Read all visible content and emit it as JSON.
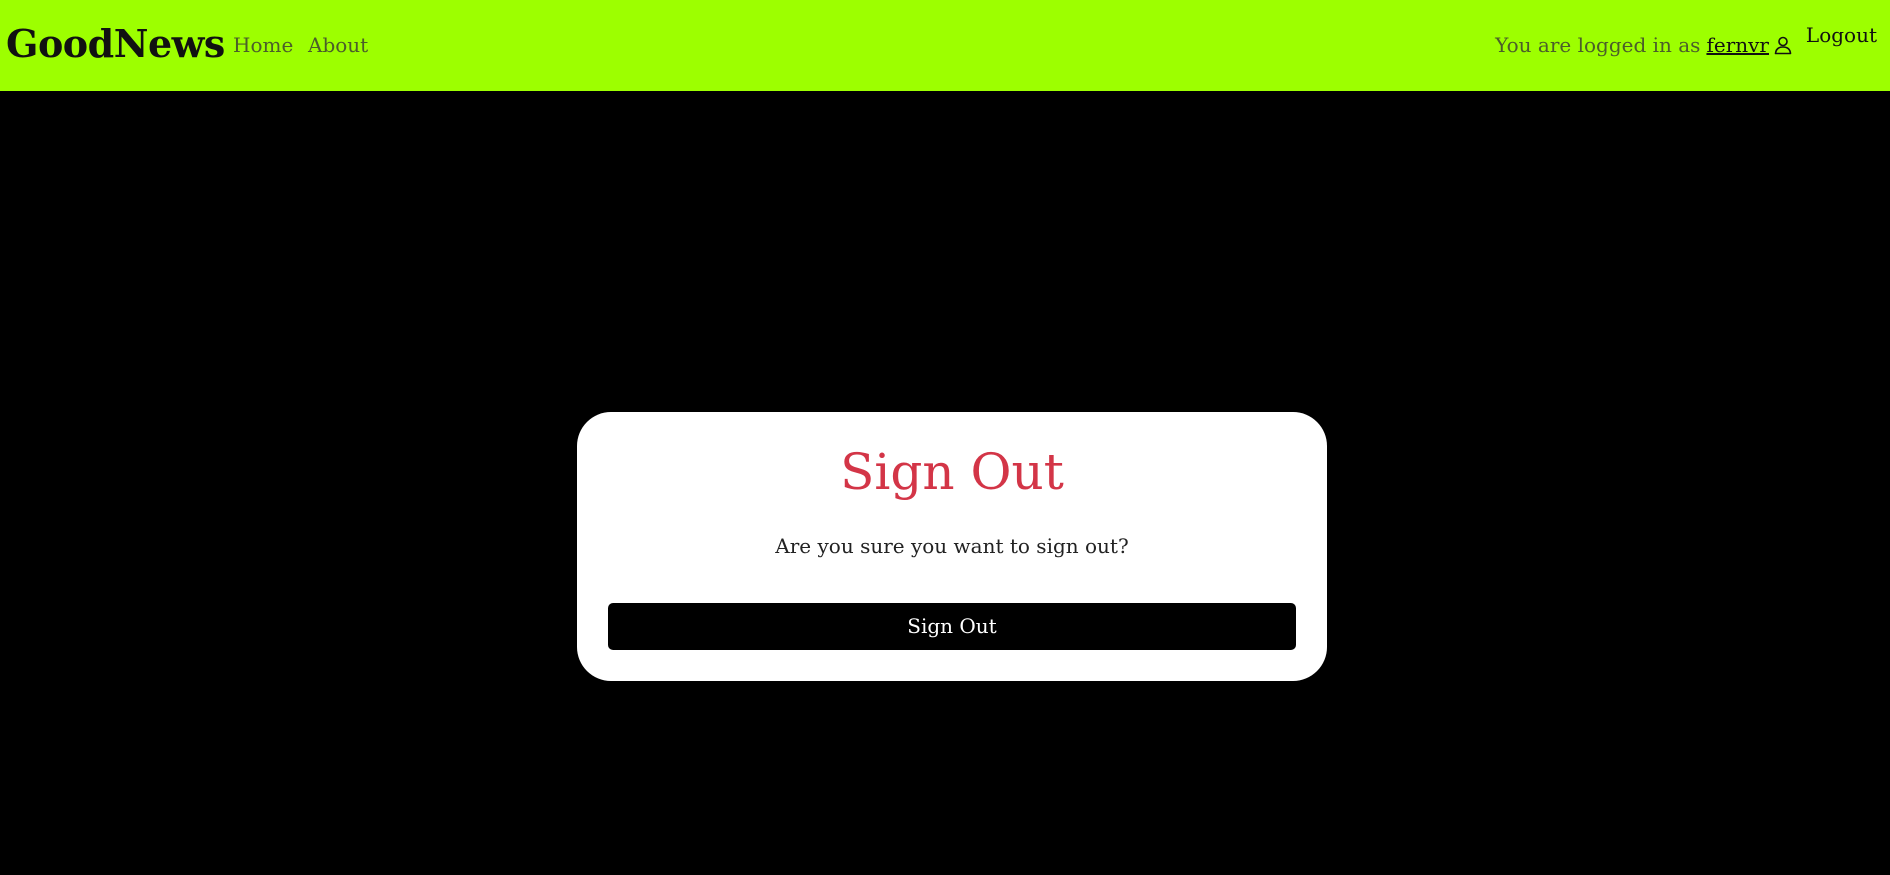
{
  "navbar": {
    "brand": "GoodNews",
    "links": [
      {
        "label": "Home"
      },
      {
        "label": "About"
      }
    ],
    "login_prefix": "You are logged in as",
    "username": "fernvr",
    "user_icon": "user-icon",
    "logout_label": "Logout"
  },
  "card": {
    "title": "Sign Out",
    "message": "Are you sure you want to sign out?",
    "button_label": "Sign Out"
  },
  "colors": {
    "navbar_bg": "#9dff00",
    "page_bg": "#000000",
    "title_color": "#d33547",
    "button_bg": "#000000"
  }
}
